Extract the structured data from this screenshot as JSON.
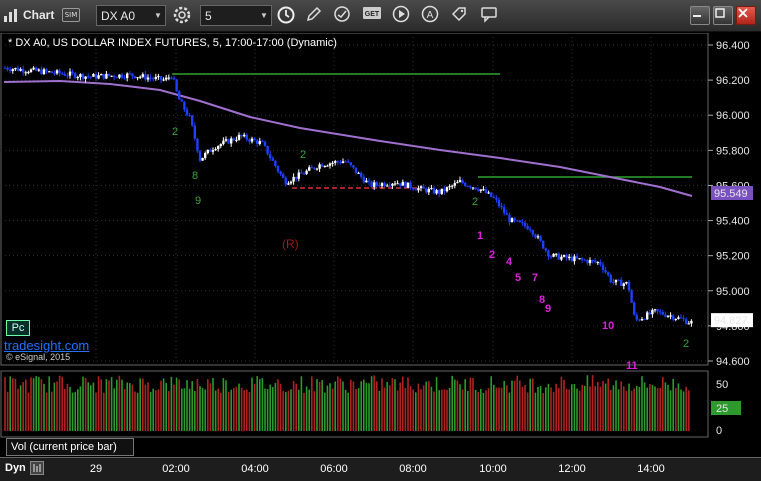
{
  "toolbar": {
    "title": "Chart",
    "sim_badge": "SIM",
    "symbol_value": "DX A0",
    "interval_value": "5",
    "buttons": [
      "settings-icon",
      "clock-icon",
      "pencil-icon",
      "refresh-icon",
      "get-icon",
      "play-icon",
      "alert-icon",
      "tag-icon",
      "chat-icon"
    ],
    "get_icon_text": "GET",
    "window_buttons": [
      "minimize",
      "maximize",
      "close"
    ]
  },
  "chart": {
    "title": "* DX A0, US DOLLAR INDEX FUTURES, 5, 17:00-17:00 (Dynamic)",
    "pc_badge": "Pc",
    "brand": "tradesight.com",
    "copyright": "© eSignal, 2015",
    "price_ticks": [
      "96.400",
      "96.200",
      "96.000",
      "95.800",
      "95.600",
      "95.400",
      "95.200",
      "95.000",
      "94.800",
      "94.600"
    ],
    "ma_label": "95.549",
    "last_price_label": "94.827",
    "volume_title": "Vol (current price bar)",
    "volume_ticks": [
      "50",
      "0"
    ],
    "volume_current": "25",
    "time_labels": [
      "29",
      "02:00",
      "04:00",
      "06:00",
      "08:00",
      "10:00",
      "12:00",
      "14:00"
    ],
    "dyn_label": "Dyn",
    "colors": {
      "up_bar": "#ffffff",
      "down_bar": "#1e40ff",
      "moving_average": "#a070d0",
      "resistance_line": "#2ea32e",
      "support_dashed": "#e03030",
      "vol_up": "#2c9a2c",
      "vol_down": "#b02222",
      "count_magenta": "#e020e0",
      "count_green": "#3aa63a",
      "r_marker": "#a01818"
    },
    "annotations": {
      "r_marker": "(R)",
      "magenta_counts": [
        "1",
        "2",
        "4",
        "5",
        "7",
        "8",
        "9",
        "10",
        "11"
      ],
      "green_counts": [
        "2",
        "8",
        "9",
        "2",
        "2",
        "2"
      ]
    }
  }
}
